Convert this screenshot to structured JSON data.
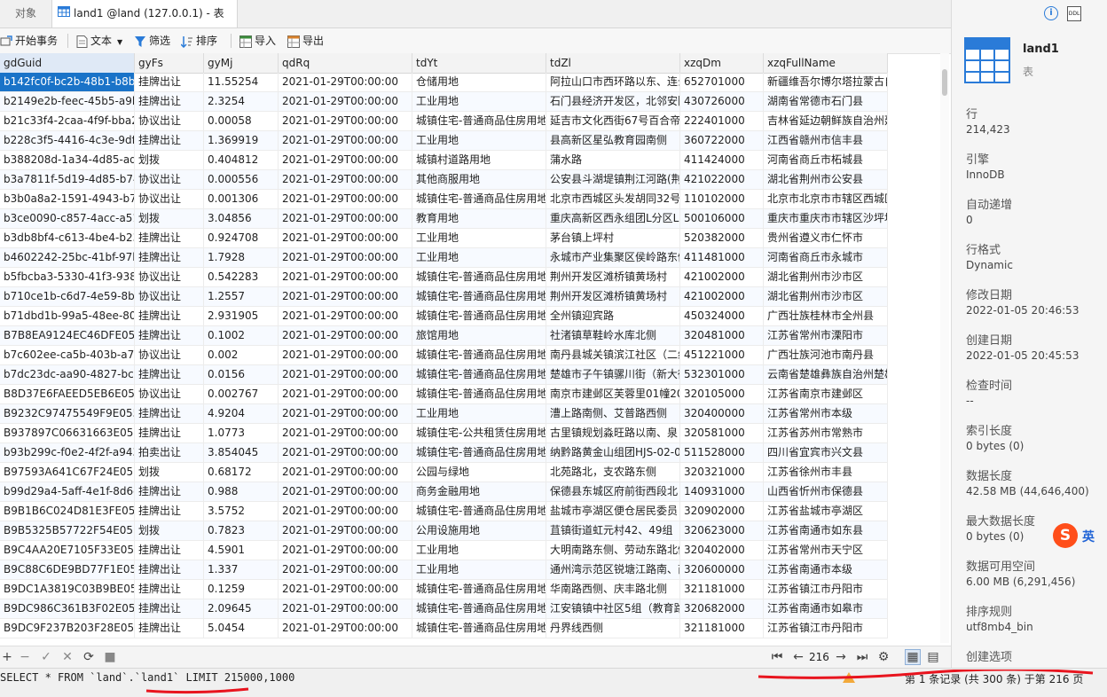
{
  "tabs": [
    {
      "label": "对象"
    },
    {
      "label": "land1 @land (127.0.0.1) - 表"
    }
  ],
  "toolbar": {
    "begin_tx": "开始事务",
    "text": "文本",
    "filter": "筛选",
    "sort": "排序",
    "import": "导入",
    "export": "导出"
  },
  "columns": [
    "gdGuid",
    "gyFs",
    "gyMj",
    "qdRq",
    "tdYt",
    "tdZl",
    "xzqDm",
    "xzqFullName"
  ],
  "rows": [
    [
      "b142fc0f-bc2b-48b1-b8b4",
      "挂牌出让",
      "11.55254",
      "2021-01-29T00:00:00",
      "仓储用地",
      "阿拉山口市西环路以东、连云",
      "652701000",
      "新疆维吾尔博尔塔拉蒙古自"
    ],
    [
      "b2149e2b-feec-45b5-a9b",
      "挂牌出让",
      "2.3254",
      "2021-01-29T00:00:00",
      "工业用地",
      "石门县经济开发区，北邻安陆",
      "430726000",
      "湖南省常德市石门县"
    ],
    [
      "b21c33f4-2caa-4f9f-bba2",
      "协议出让",
      "0.00058",
      "2021-01-29T00:00:00",
      "城镇住宅-普通商品住房用地",
      "延吉市文化西街67号百合帝",
      "222401000",
      "吉林省延边朝鲜族自治州延"
    ],
    [
      "b228c3f5-4416-4c3e-9df7",
      "挂牌出让",
      "1.369919",
      "2021-01-29T00:00:00",
      "工业用地",
      "县高新区星弘教育园南侧",
      "360722000",
      "江西省赣州市信丰县"
    ],
    [
      "b388208d-1a34-4d85-adf",
      "划拨",
      "0.404812",
      "2021-01-29T00:00:00",
      "城镇村道路用地",
      "蒲水路",
      "411424000",
      "河南省商丘市柘城县"
    ],
    [
      "b3a7811f-5d19-4d85-b74",
      "协议出让",
      "0.000556",
      "2021-01-29T00:00:00",
      "其他商服用地",
      "公安县斗湖堤镇荆江河路(荆",
      "421022000",
      "湖北省荆州市公安县"
    ],
    [
      "b3b0a8a2-1591-4943-b7c",
      "协议出让",
      "0.001306",
      "2021-01-29T00:00:00",
      "城镇住宅-普通商品住房用地",
      "北京市西城区头发胡同32号",
      "110102000",
      "北京市北京市市辖区西城区"
    ],
    [
      "b3ce0090-c857-4acc-a51",
      "划拨",
      "3.04856",
      "2021-01-29T00:00:00",
      "教育用地",
      "重庆高新区西永组团L分区L6",
      "500106000",
      "重庆市重庆市市辖区沙坪坝"
    ],
    [
      "b3db8bf4-c613-4be4-b23",
      "挂牌出让",
      "0.924708",
      "2021-01-29T00:00:00",
      "工业用地",
      "茅台镇上坪村",
      "520382000",
      "贵州省遵义市仁怀市"
    ],
    [
      "b4602242-25bc-41bf-97b",
      "挂牌出让",
      "1.7928",
      "2021-01-29T00:00:00",
      "工业用地",
      "永城市产业集聚区侯岭路东侧",
      "411481000",
      "河南省商丘市永城市"
    ],
    [
      "b5fbcba3-5330-41f3-9384",
      "协议出让",
      "0.542283",
      "2021-01-29T00:00:00",
      "城镇住宅-普通商品住房用地",
      "荆州开发区滩桥镇黄场村",
      "421002000",
      "湖北省荆州市沙市区"
    ],
    [
      "b710ce1b-c6d7-4e59-8bc",
      "协议出让",
      "1.2557",
      "2021-01-29T00:00:00",
      "城镇住宅-普通商品住房用地",
      "荆州开发区滩桥镇黄场村",
      "421002000",
      "湖北省荆州市沙市区"
    ],
    [
      "b71dbd1b-99a5-48ee-80c",
      "挂牌出让",
      "2.931905",
      "2021-01-29T00:00:00",
      "城镇住宅-普通商品住房用地",
      "全州镇迎宾路",
      "450324000",
      "广西壮族桂林市全州县"
    ],
    [
      "B7B8EA9124EC46DFE0550",
      "挂牌出让",
      "0.1002",
      "2021-01-29T00:00:00",
      "旅馆用地",
      "社渚镇草鞋岭水库北侧",
      "320481000",
      "江苏省常州市溧阳市"
    ],
    [
      "b7c602ee-ca5b-403b-a70",
      "协议出让",
      "0.002",
      "2021-01-29T00:00:00",
      "城镇住宅-普通商品住房用地",
      "南丹县城关镇滨江社区（二组",
      "451221000",
      "广西壮族河池市南丹县"
    ],
    [
      "b7dc23dc-aa90-4827-bce",
      "挂牌出让",
      "0.0156",
      "2021-01-29T00:00:00",
      "城镇住宅-普通商品住房用地",
      "楚雄市子午镇骡川街（新大街",
      "532301000",
      "云南省楚雄彝族自治州楚雄"
    ],
    [
      "B8D37E6FAEED5EB6E0550",
      "协议出让",
      "0.002767",
      "2021-01-29T00:00:00",
      "城镇住宅-普通商品住房用地",
      "南京市建邺区芙蓉里01幢20",
      "320105000",
      "江苏省南京市建邺区"
    ],
    [
      "B9232C97475549F9E0550",
      "挂牌出让",
      "4.9204",
      "2021-01-29T00:00:00",
      "工业用地",
      "漕上路南侧、艾普路西侧",
      "320400000",
      "江苏省常州市本级"
    ],
    [
      "B937897C06631663E0550",
      "挂牌出让",
      "1.0773",
      "2021-01-29T00:00:00",
      "城镇住宅-公共租赁住房用地",
      "古里镇规划淼旺路以南、泉",
      "320581000",
      "江苏省苏州市常熟市"
    ],
    [
      "b93b299c-f0e2-4f2f-a943",
      "拍卖出让",
      "3.854045",
      "2021-01-29T00:00:00",
      "城镇住宅-普通商品住房用地",
      "纳黔路黄金山组团HJS-02-0",
      "511528000",
      "四川省宜宾市兴文县"
    ],
    [
      "B97593A641C67F24E0550",
      "划拨",
      "0.68172",
      "2021-01-29T00:00:00",
      "公园与绿地",
      "北苑路北，支农路东侧",
      "320321000",
      "江苏省徐州市丰县"
    ],
    [
      "b99d29a4-5aff-4e1f-8d6c",
      "挂牌出让",
      "0.988",
      "2021-01-29T00:00:00",
      "商务金融用地",
      "保德县东城区府前街西段北",
      "140931000",
      "山西省忻州市保德县"
    ],
    [
      "B9B1B6C024D81E3FE0550",
      "挂牌出让",
      "3.5752",
      "2021-01-29T00:00:00",
      "城镇住宅-普通商品住房用地",
      "盐城市亭湖区便仓居民委员",
      "320902000",
      "江苏省盐城市亭湖区"
    ],
    [
      "B9B5325B57722F54E0550",
      "划拨",
      "0.7823",
      "2021-01-29T00:00:00",
      "公用设施用地",
      "苴镇街道虹元村42、49组",
      "320623000",
      "江苏省南通市如东县"
    ],
    [
      "B9C4AA20E7105F33E0550",
      "挂牌出让",
      "4.5901",
      "2021-01-29T00:00:00",
      "工业用地",
      "大明南路东侧、劳动东路北侧",
      "320402000",
      "江苏省常州市天宁区"
    ],
    [
      "B9C88C6DE9BD77F1E0550",
      "挂牌出让",
      "1.337",
      "2021-01-29T00:00:00",
      "工业用地",
      "通州湾示范区锐塘江路南、商",
      "320600000",
      "江苏省南通市本级"
    ],
    [
      "B9DC1A3819C03B9BE0550",
      "挂牌出让",
      "0.1259",
      "2021-01-29T00:00:00",
      "城镇住宅-普通商品住房用地",
      "华南路西侧、庆丰路北侧",
      "321181000",
      "江苏省镇江市丹阳市"
    ],
    [
      "B9DC986C361B3F02E0550",
      "挂牌出让",
      "2.09645",
      "2021-01-29T00:00:00",
      "城镇住宅-普通商品住房用地",
      "江安镇镇中社区5组（教育路",
      "320682000",
      "江苏省南通市如皋市"
    ],
    [
      "B9DC9F237B203F28E0550",
      "挂牌出让",
      "5.0454",
      "2021-01-29T00:00:00",
      "城镇住宅-普通商品住房用地",
      "丹界线西侧",
      "321181000",
      "江苏省镇江市丹阳市"
    ]
  ],
  "pager": {
    "page": "216"
  },
  "status": {
    "sql": "SELECT * FROM `land`.`land1` LIMIT 215000,1000",
    "record_info": "第 1 条记录 (共 300 条) 于第 216 页"
  },
  "panel": {
    "name": "land1",
    "type": "表",
    "props": [
      {
        "label": "行",
        "value": "214,423"
      },
      {
        "label": "引擎",
        "value": "InnoDB"
      },
      {
        "label": "自动递增",
        "value": "0"
      },
      {
        "label": "行格式",
        "value": "Dynamic"
      },
      {
        "label": "修改日期",
        "value": "2022-01-05 20:46:53"
      },
      {
        "label": "创建日期",
        "value": "2022-01-05 20:45:53"
      },
      {
        "label": "检查时间",
        "value": "--"
      },
      {
        "label": "索引长度",
        "value": "0 bytes (0)"
      },
      {
        "label": "数据长度",
        "value": "42.58 MB (44,646,400)"
      },
      {
        "label": "最大数据长度",
        "value": "0 bytes (0)"
      },
      {
        "label": "数据可用空间",
        "value": "6.00 MB (6,291,456)"
      },
      {
        "label": "排序规则",
        "value": "utf8mb4_bin"
      },
      {
        "label": "创建选项",
        "value": ""
      }
    ],
    "ime_label": "英"
  },
  "colors": {
    "selected": "#1a73c8",
    "annotation": "#e8141e",
    "accent": "#2a7bd8"
  }
}
